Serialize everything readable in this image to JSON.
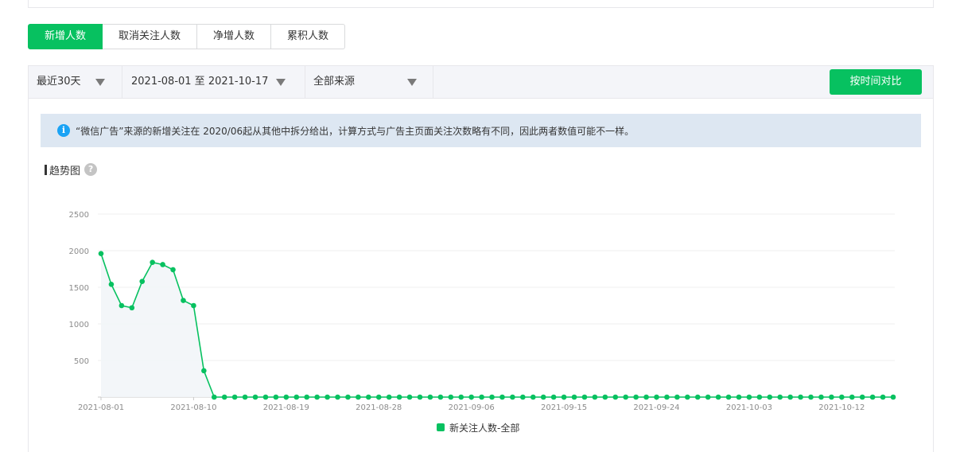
{
  "tabs": [
    {
      "label": "新增人数",
      "active": true
    },
    {
      "label": "取消关注人数",
      "active": false
    },
    {
      "label": "净增人数",
      "active": false
    },
    {
      "label": "累积人数",
      "active": false
    }
  ],
  "filters": {
    "period": "最近30天",
    "date_range": "2021-08-01 至 2021-10-17",
    "source": "全部来源",
    "compare_button": "按时间对比"
  },
  "notice": {
    "icon": "info-icon",
    "text": "“微信广告”来源的新增关注在 2020/06起从其他中拆分给出，计算方式与广告主页面关注次数略有不同，因此两者数值可能不一样。"
  },
  "section": {
    "title": "趋势图",
    "help_icon": "?"
  },
  "colors": {
    "accent": "#07c160",
    "notice_bg": "#dde7f2",
    "info": "#1aa3f5"
  },
  "chart_data": {
    "type": "line",
    "x_start": "2021-08-01",
    "x_end": "2021-10-17",
    "x_tick_labels": [
      "2021-08-01",
      "2021-08-10",
      "2021-08-19",
      "2021-08-28",
      "2021-09-06",
      "2021-09-15",
      "2021-09-24",
      "2021-10-03",
      "2021-10-12"
    ],
    "y_tick_labels": [
      "500",
      "1000",
      "1500",
      "2000",
      "2500"
    ],
    "ylim": [
      0,
      2500
    ],
    "grid": true,
    "legend_position": "bottom",
    "series": [
      {
        "name": "新关注人数-全部",
        "color": "#07c160",
        "values": [
          1960,
          1540,
          1250,
          1220,
          1580,
          1840,
          1810,
          1740,
          1320,
          1250,
          360,
          0,
          0,
          0,
          0,
          0,
          0,
          0,
          0,
          0,
          0,
          0,
          0,
          0,
          0,
          0,
          0,
          0,
          0,
          0,
          0,
          0,
          0,
          0,
          0,
          0,
          0,
          0,
          0,
          0,
          0,
          0,
          0,
          0,
          0,
          0,
          0,
          0,
          0,
          0,
          0,
          0,
          0,
          0,
          0,
          0,
          0,
          0,
          0,
          0,
          0,
          0,
          0,
          0,
          0,
          0,
          0,
          0,
          0,
          0,
          0,
          0,
          0,
          0,
          0,
          0,
          0,
          0
        ]
      }
    ]
  }
}
